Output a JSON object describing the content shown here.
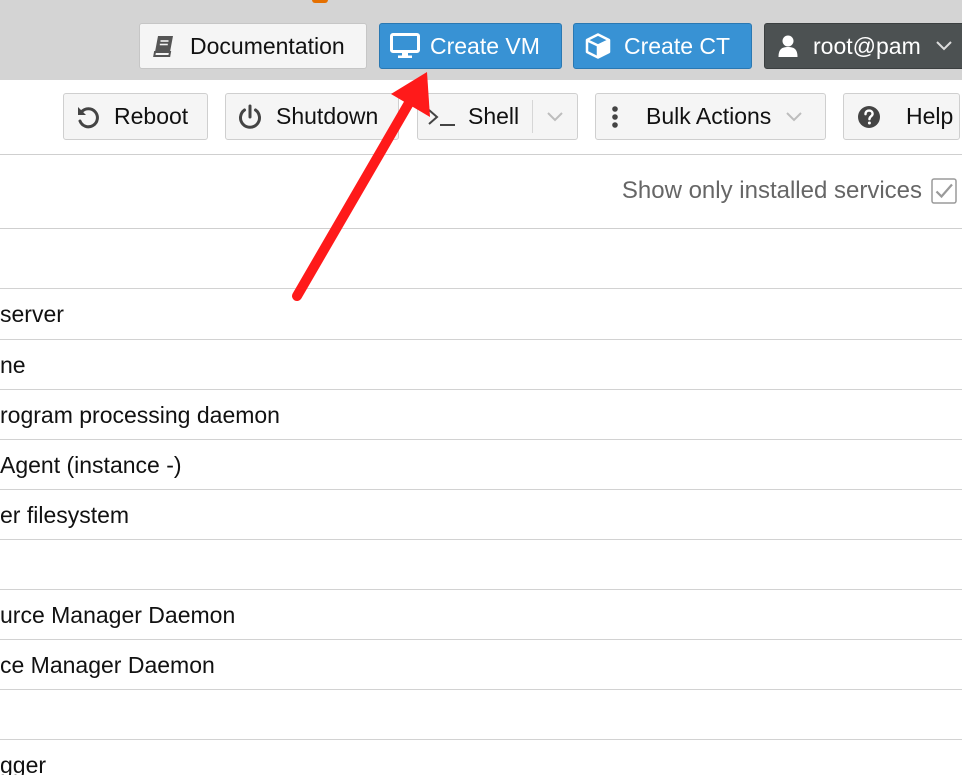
{
  "header": {
    "documentation_label": "Documentation",
    "create_vm_label": "Create VM",
    "create_ct_label": "Create CT",
    "user_label": "root@pam"
  },
  "toolbar": {
    "reboot_label": "Reboot",
    "shutdown_label": "Shutdown",
    "shell_label": "Shell",
    "bulk_actions_label": "Bulk Actions",
    "help_label": "Help"
  },
  "filter": {
    "show_installed_label": "Show only installed services",
    "show_installed_checked": true
  },
  "services": [
    {
      "description": ""
    },
    {
      "description": "server"
    },
    {
      "description": "ne"
    },
    {
      "description": "rogram processing daemon"
    },
    {
      "description": "Agent (instance -)"
    },
    {
      "description": "er filesystem"
    },
    {
      "description": ""
    },
    {
      "description": "urce Manager Daemon"
    },
    {
      "description": "ce Manager Daemon"
    },
    {
      "description": ""
    },
    {
      "description": "gger"
    }
  ],
  "colors": {
    "header_bg": "#d4d4d4",
    "primary_button": "#3892d4",
    "user_button": "#4c5152",
    "annotation_arrow": "#ff1a1a"
  },
  "icons": {
    "documentation": "book-icon",
    "create_vm": "monitor-icon",
    "create_ct": "cube-icon",
    "user": "user-icon",
    "reboot": "undo-icon",
    "shutdown": "power-icon",
    "shell": "terminal-icon",
    "bulk_actions": "ellipsis-vertical-icon",
    "help": "question-circle-icon"
  }
}
